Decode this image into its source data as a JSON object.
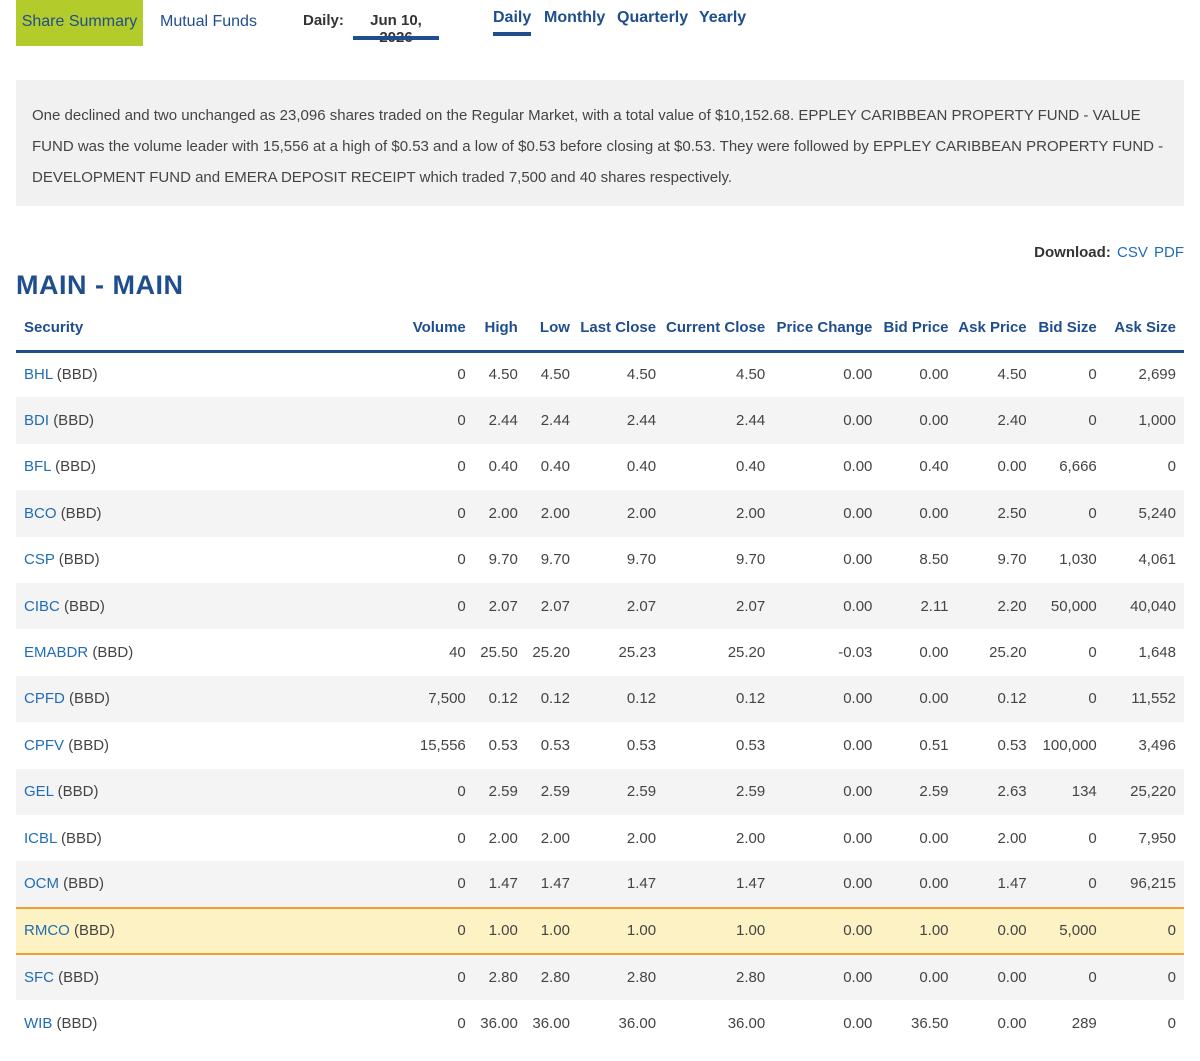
{
  "tabs": {
    "share_summary": "Share Summary",
    "mutual_funds": "Mutual Funds"
  },
  "daily": {
    "label": "Daily:",
    "date": "Jun 10, 2026"
  },
  "periods": [
    "Daily",
    "Monthly",
    "Quarterly",
    "Yearly"
  ],
  "summary_text": "One declined and two unchanged as 23,096 shares traded on the Regular Market, with a total value of $10,152.68. EPPLEY CARIBBEAN PROPERTY FUND - VALUE FUND was the volume leader with 15,556 at a high of $0.53 and a low of $0.53 before closing at $0.53. They were followed by EPPLEY CARIBBEAN PROPERTY FUND - DEVELOPMENT FUND and EMERA DEPOSIT RECEIPT which traded 7,500 and 40 shares respectively.",
  "download": {
    "label": "Download:",
    "csv": "CSV",
    "pdf": "PDF"
  },
  "section_title": "MAIN - MAIN",
  "columns": [
    "Security",
    "Volume",
    "High",
    "Low",
    "Last Close",
    "Current Close",
    "Price Change",
    "Bid Price",
    "Ask Price",
    "Bid Size",
    "Ask Size"
  ],
  "rows": [
    {
      "sym": "BHL",
      "cur": "(BBD)",
      "vals": [
        "0",
        "4.50",
        "4.50",
        "4.50",
        "4.50",
        "0.00",
        "0.00",
        "4.50",
        "0",
        "2,699"
      ]
    },
    {
      "sym": "BDI",
      "cur": "(BBD)",
      "vals": [
        "0",
        "2.44",
        "2.44",
        "2.44",
        "2.44",
        "0.00",
        "0.00",
        "2.40",
        "0",
        "1,000"
      ]
    },
    {
      "sym": "BFL",
      "cur": "(BBD)",
      "vals": [
        "0",
        "0.40",
        "0.40",
        "0.40",
        "0.40",
        "0.00",
        "0.40",
        "0.00",
        "6,666",
        "0"
      ]
    },
    {
      "sym": "BCO",
      "cur": "(BBD)",
      "vals": [
        "0",
        "2.00",
        "2.00",
        "2.00",
        "2.00",
        "0.00",
        "0.00",
        "2.50",
        "0",
        "5,240"
      ]
    },
    {
      "sym": "CSP",
      "cur": "(BBD)",
      "vals": [
        "0",
        "9.70",
        "9.70",
        "9.70",
        "9.70",
        "0.00",
        "8.50",
        "9.70",
        "1,030",
        "4,061"
      ]
    },
    {
      "sym": "CIBC",
      "cur": "(BBD)",
      "vals": [
        "0",
        "2.07",
        "2.07",
        "2.07",
        "2.07",
        "0.00",
        "2.11",
        "2.20",
        "50,000",
        "40,040"
      ]
    },
    {
      "sym": "EMABDR",
      "cur": "(BBD)",
      "vals": [
        "40",
        "25.50",
        "25.20",
        "25.23",
        "25.20",
        "-0.03",
        "0.00",
        "25.20",
        "0",
        "1,648"
      ]
    },
    {
      "sym": "CPFD",
      "cur": "(BBD)",
      "vals": [
        "7,500",
        "0.12",
        "0.12",
        "0.12",
        "0.12",
        "0.00",
        "0.00",
        "0.12",
        "0",
        "11,552"
      ]
    },
    {
      "sym": "CPFV",
      "cur": "(BBD)",
      "vals": [
        "15,556",
        "0.53",
        "0.53",
        "0.53",
        "0.53",
        "0.00",
        "0.51",
        "0.53",
        "100,000",
        "3,496"
      ]
    },
    {
      "sym": "GEL",
      "cur": "(BBD)",
      "vals": [
        "0",
        "2.59",
        "2.59",
        "2.59",
        "2.59",
        "0.00",
        "2.59",
        "2.63",
        "134",
        "25,220"
      ]
    },
    {
      "sym": "ICBL",
      "cur": "(BBD)",
      "vals": [
        "0",
        "2.00",
        "2.00",
        "2.00",
        "2.00",
        "0.00",
        "0.00",
        "2.00",
        "0",
        "7,950"
      ]
    },
    {
      "sym": "OCM",
      "cur": "(BBD)",
      "vals": [
        "0",
        "1.47",
        "1.47",
        "1.47",
        "1.47",
        "0.00",
        "0.00",
        "1.47",
        "0",
        "96,215"
      ]
    },
    {
      "sym": "RMCO",
      "cur": "(BBD)",
      "vals": [
        "0",
        "1.00",
        "1.00",
        "1.00",
        "1.00",
        "0.00",
        "1.00",
        "0.00",
        "5,000",
        "0"
      ],
      "highlight": true
    },
    {
      "sym": "SFC",
      "cur": "(BBD)",
      "vals": [
        "0",
        "2.80",
        "2.80",
        "2.80",
        "2.80",
        "0.00",
        "0.00",
        "0.00",
        "0",
        "0"
      ]
    },
    {
      "sym": "WIB",
      "cur": "(BBD)",
      "vals": [
        "0",
        "36.00",
        "36.00",
        "36.00",
        "36.00",
        "0.00",
        "36.50",
        "0.00",
        "289",
        "0"
      ]
    }
  ],
  "colors": {
    "brand_blue": "#1f4e8c",
    "link_blue": "#1f6db5",
    "active_tab_green": "#b3cc2c",
    "highlight_row": "#fcf2c3",
    "highlight_border": "#f0a030"
  }
}
